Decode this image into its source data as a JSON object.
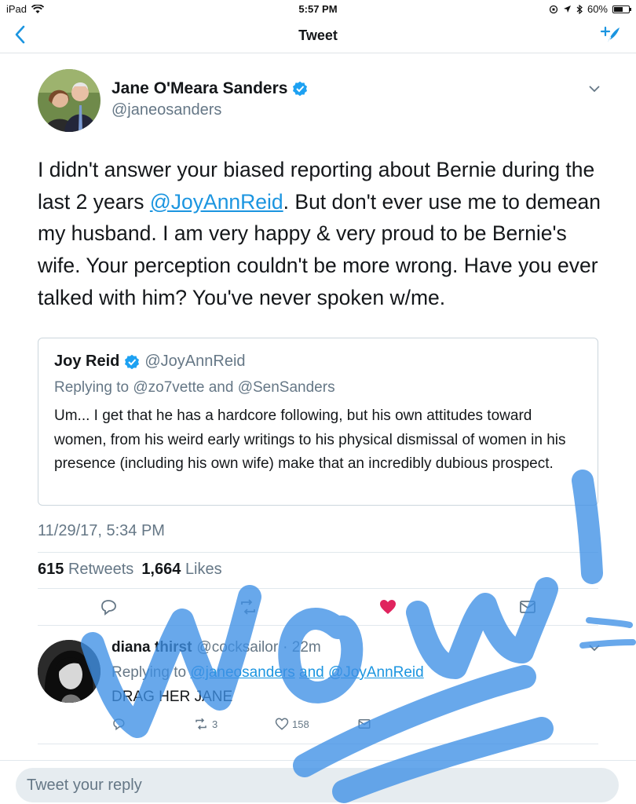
{
  "status_bar": {
    "device": "iPad",
    "time": "5:57 PM",
    "battery": "60%",
    "battery_level": 0.6
  },
  "nav": {
    "title": "Tweet"
  },
  "tweet": {
    "author_name": "Jane O'Meara Sanders",
    "author_handle": "@janeosanders",
    "text_before": "I didn't answer your biased reporting about Bernie during the last 2 years ",
    "mention": "@JoyAnnReid",
    "text_after": ". But don't ever use me to demean my husband. I am very happy & very proud to be Bernie's wife. Your perception couldn't be more wrong. Have you ever talked with him? You've never spoken w/me.",
    "timestamp": "11/29/17, 5:34 PM",
    "retweets_count": "615",
    "retweets_label": "Retweets",
    "likes_count": "1,664",
    "likes_label": "Likes"
  },
  "quoted": {
    "name": "Joy Reid",
    "handle": "@JoyAnnReid",
    "replying": "Replying to @zo7vette and @SenSanders",
    "text": "Um... I get that he has a hardcore following, but his own attitudes toward women, from his weird early writings to his physical dismissal of women in his presence (including his own wife) make that an incredibly dubious prospect."
  },
  "reply": {
    "name": "diana thirst",
    "handle": "@cocksailor",
    "age": "· 22m",
    "replying_prefix": "Replying to",
    "replying_mention1": "@janeosanders",
    "replying_and": "and",
    "replying_mention2": "@JoyAnnReid",
    "text": "DRAG HER JANE",
    "retweets": "3",
    "likes": "158"
  },
  "reply_bar": {
    "placeholder": "Tweet your reply"
  },
  "colors": {
    "accent": "#1b95e0",
    "like": "#e0245e",
    "overlay": "#3d8fe6"
  }
}
